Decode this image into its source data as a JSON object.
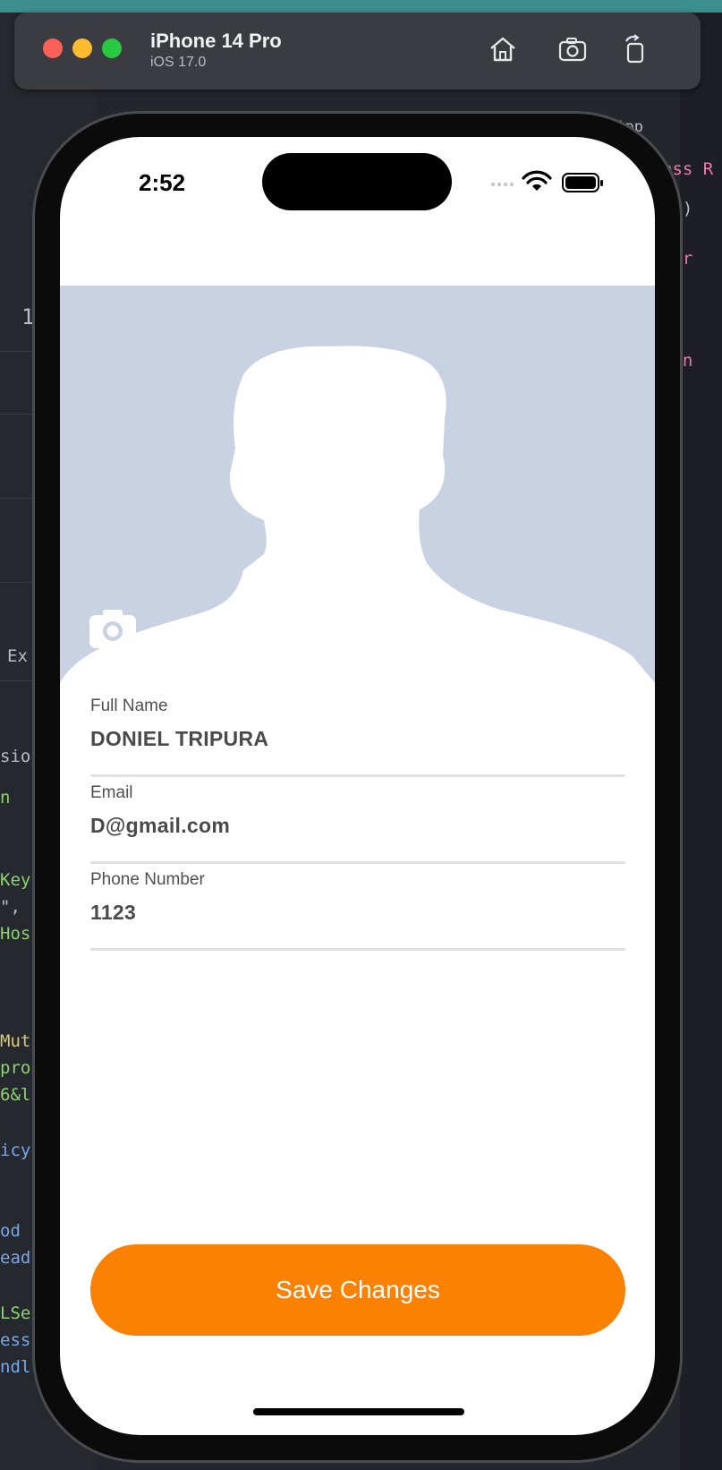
{
  "simulator": {
    "device_name": "iPhone 14 Pro",
    "os_version": "iOS 17.0",
    "icons": [
      "home-icon",
      "screenshot-icon",
      "rotate-icon"
    ]
  },
  "background_code": {
    "right_snippets": [
      "ass R",
      "}()",
      "var",
      "fun"
    ],
    "left_snippets": [
      "1",
      "Ex",
      "sion",
      "n",
      "Key",
      "\",",
      "Hos",
      "Mut",
      "pro",
      "6&l",
      "icy",
      "od",
      "ead",
      "LSe",
      "ess",
      "ndl"
    ],
    "breadcrumb_fragment": "lApp"
  },
  "status_bar": {
    "time": "2:52"
  },
  "profile": {
    "photo_icon": "person-silhouette",
    "camera_icon": "camera-icon",
    "fields": [
      {
        "label": "Full Name",
        "value": "DONIEL TRIPURA"
      },
      {
        "label": "Email",
        "value": "D@gmail.com"
      },
      {
        "label": "Phone Number",
        "value": "1123"
      }
    ]
  },
  "actions": {
    "save_label": "Save Changes"
  },
  "colors": {
    "accent": "#fb8103",
    "photo_background": "#c9d2e2",
    "divider": "#e2e2e2"
  }
}
